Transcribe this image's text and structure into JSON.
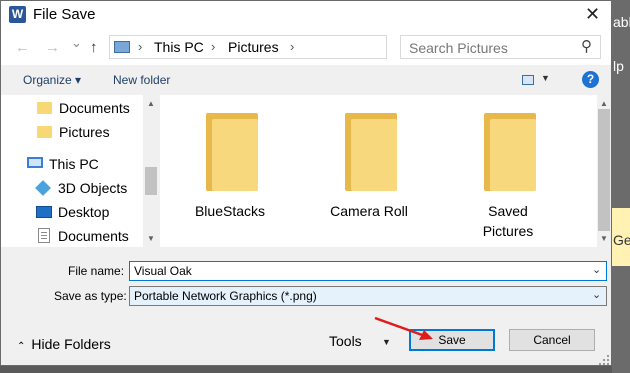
{
  "window": {
    "title": "File Save",
    "app_icon": "word-icon",
    "close_glyph": "✕"
  },
  "background_app": {
    "fragments": [
      "abl",
      "lp",
      "Get"
    ]
  },
  "nav": {
    "back_glyph": "←",
    "forward_glyph": "→",
    "recent_glyph": "⌄",
    "up_glyph": "↑",
    "breadcrumb": [
      "This PC",
      "Pictures"
    ],
    "separator": "›",
    "dropdown_glyph": "⌄",
    "refresh_glyph": "↻"
  },
  "search": {
    "placeholder": "Search Pictures",
    "icon_glyph": "⚲"
  },
  "toolbar": {
    "organize_label": "Organize ▾",
    "new_folder_label": "New folder",
    "help_glyph": "?",
    "view_drop_glyph": "▼"
  },
  "sidebar": {
    "items": [
      {
        "label": "Documents",
        "icon": "folder-icon"
      },
      {
        "label": "Pictures",
        "icon": "folder-icon"
      },
      {
        "label": "This PC",
        "icon": "computer-icon"
      },
      {
        "label": "3D Objects",
        "icon": "cube-icon"
      },
      {
        "label": "Desktop",
        "icon": "desktop-icon"
      },
      {
        "label": "Documents",
        "icon": "document-icon"
      }
    ]
  },
  "files": [
    {
      "name": "BlueStacks"
    },
    {
      "name": "Camera Roll"
    },
    {
      "name": "Saved Pictures"
    }
  ],
  "form": {
    "file_name_label": "File name:",
    "file_name_value": "Visual Oak",
    "save_type_label": "Save as type:",
    "save_type_value": "Portable Network Graphics (*.png)",
    "chevron_glyph": "⌄"
  },
  "bottom": {
    "hide_folders_label": "Hide Folders",
    "hide_caret": "⌃",
    "tools_label": "Tools",
    "tools_drop_glyph": "▼",
    "save_label": "Save",
    "cancel_label": "Cancel"
  },
  "colors": {
    "accent": "#0078d7",
    "annotation_arrow": "#e01b1b",
    "folder": "#f8d87c"
  }
}
